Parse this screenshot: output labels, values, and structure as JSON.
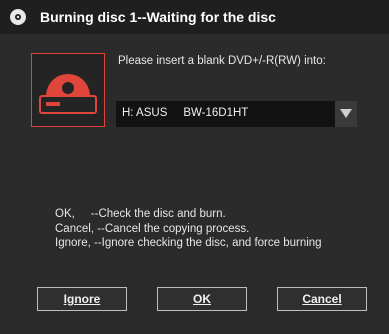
{
  "window": {
    "title": "Burning disc 1--Waiting for the disc",
    "icon": "disc-icon"
  },
  "colors": {
    "accent": "#e0453b",
    "background": "#2b2b2b",
    "titlebar": "#1f1f1f"
  },
  "main": {
    "drive_icon": "optical-drive-icon",
    "prompt": "Please insert a blank DVD+/-R(RW) into:",
    "drive_select": {
      "selected": "H: ASUS     BW-16D1HT"
    },
    "help_lines": [
      "OK,     --Check the disc and burn.",
      "Cancel, --Cancel the copying process.",
      "Ignore, --Ignore checking the disc, and force burning"
    ]
  },
  "buttons": {
    "ignore": "Ignore",
    "ok": "OK",
    "cancel": "Cancel"
  }
}
